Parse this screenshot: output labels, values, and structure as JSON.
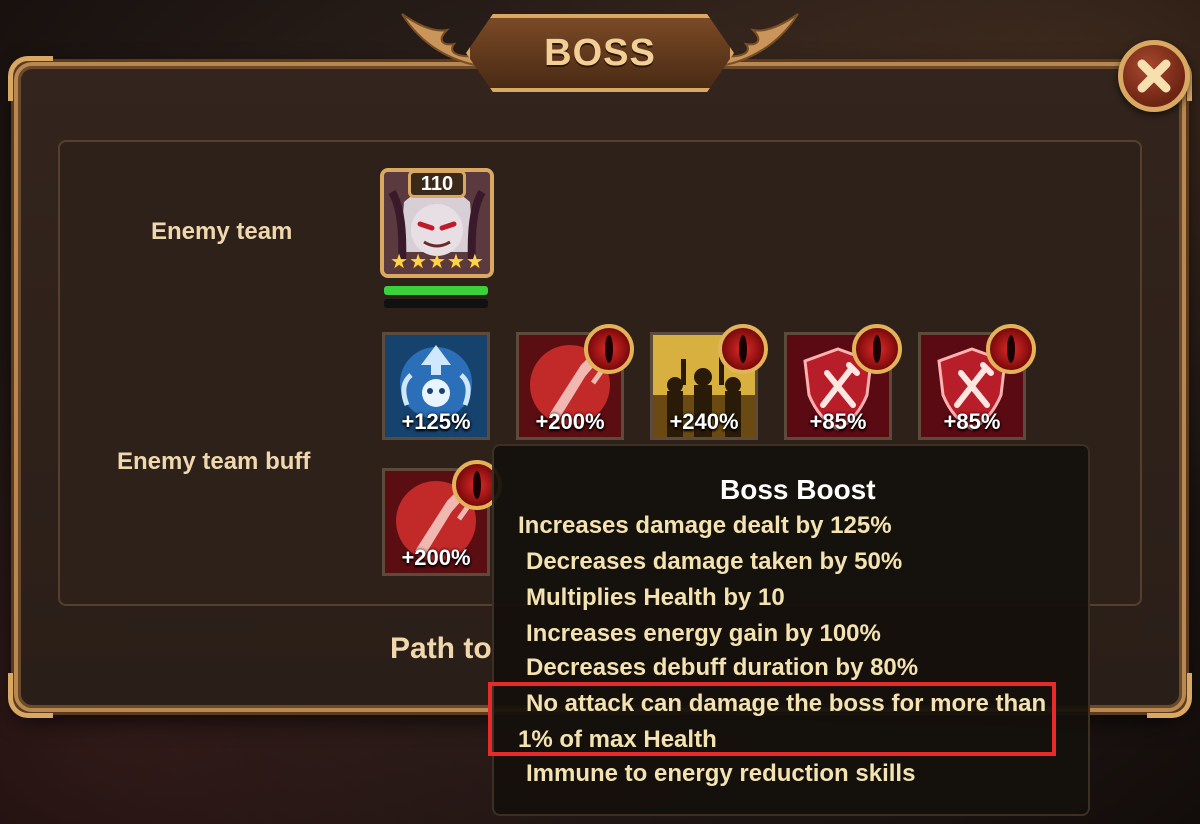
{
  "window": {
    "title": "BOSS",
    "close_icon": "close-x-icon"
  },
  "labels": {
    "enemy_team": "Enemy team",
    "enemy_team_buff": "Enemy team buff"
  },
  "hero": {
    "level": "110",
    "stars": 5,
    "health_fraction": 1.0,
    "energy_fraction": 0.0
  },
  "buffs": [
    {
      "value": "+125%",
      "icon": "skull-arrow-up-icon",
      "has_eye": false,
      "color": "#2a6fb8"
    },
    {
      "value": "+200%",
      "icon": "sword-up-icon",
      "has_eye": true,
      "color": "#c22a2a"
    },
    {
      "value": "+240%",
      "icon": "crowd-cheer-icon",
      "has_eye": true,
      "color": "#c89a2a"
    },
    {
      "value": "+85%",
      "icon": "shield-sword-icon",
      "has_eye": true,
      "color": "#b81e2a"
    },
    {
      "value": "+85%",
      "icon": "shield-sword-icon",
      "has_eye": true,
      "color": "#b81e2a"
    },
    {
      "value": "+200%",
      "icon": "sword-up-icon",
      "has_eye": true,
      "color": "#c22a2a"
    }
  ],
  "path_text": "Path to",
  "tooltip": {
    "title": "Boss Boost",
    "lines": [
      "Increases damage dealt by 125%",
      "Decreases damage taken by 50%",
      "Multiplies Health by 10",
      "Increases energy gain by 100%",
      "Decreases debuff duration by 80%",
      "No attack can damage the boss for more than",
      "1% of max Health",
      "Immune to energy reduction skills"
    ]
  },
  "colors": {
    "gold_border": "#d9a862",
    "highlight_red": "#e82a2a",
    "panel_bg": "#2a1e18"
  }
}
